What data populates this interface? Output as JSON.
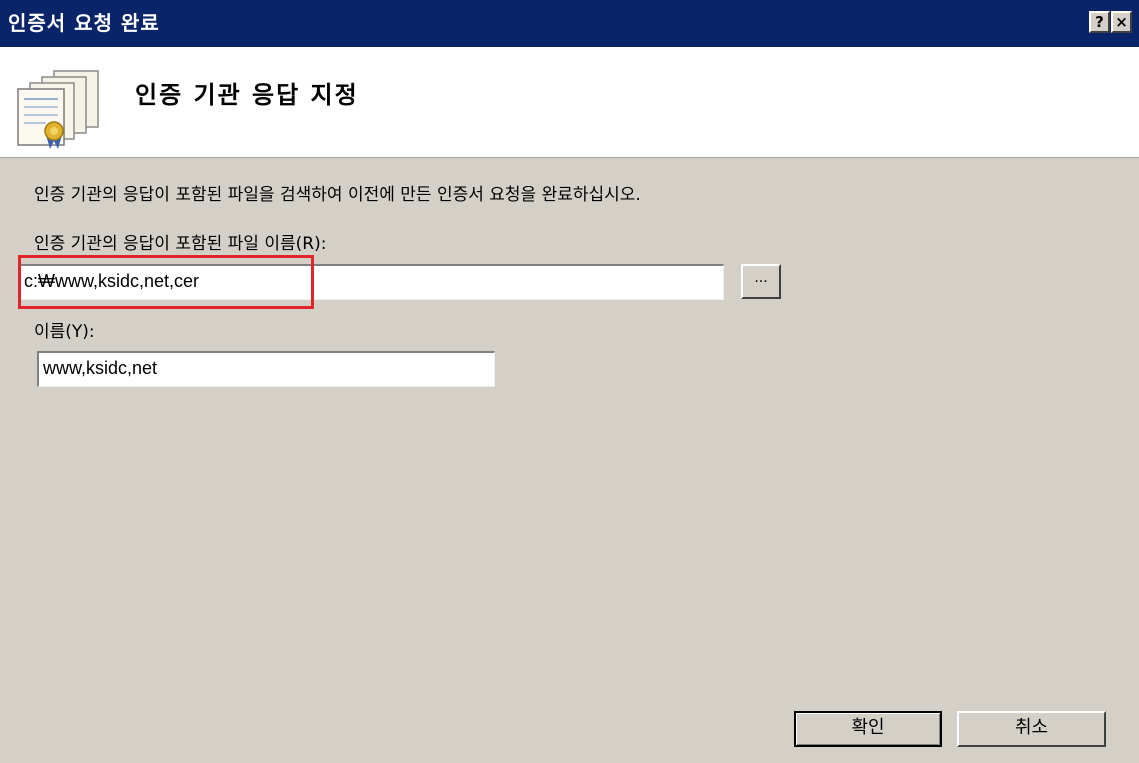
{
  "window": {
    "title": "인증서 요청 완료",
    "help_label": "?",
    "close_label": "×"
  },
  "header": {
    "title": "인증 기관 응답 지정",
    "icon": "certificate-icon"
  },
  "form": {
    "instruction": "인증 기관의 응답이 포함된 파일을 검색하여 이전에 만든 인증서 요청을 완료하십시오.",
    "file_label": "인증 기관의 응답이 포함된 파일 이름(R):",
    "file_value": "c:₩www,ksidc,net,cer",
    "browse_label": "...",
    "name_label": "이름(Y):",
    "name_value": "www,ksidc,net",
    "highlight_color": "#e0262b"
  },
  "buttons": {
    "ok_label": "확인",
    "cancel_label": "취소"
  }
}
